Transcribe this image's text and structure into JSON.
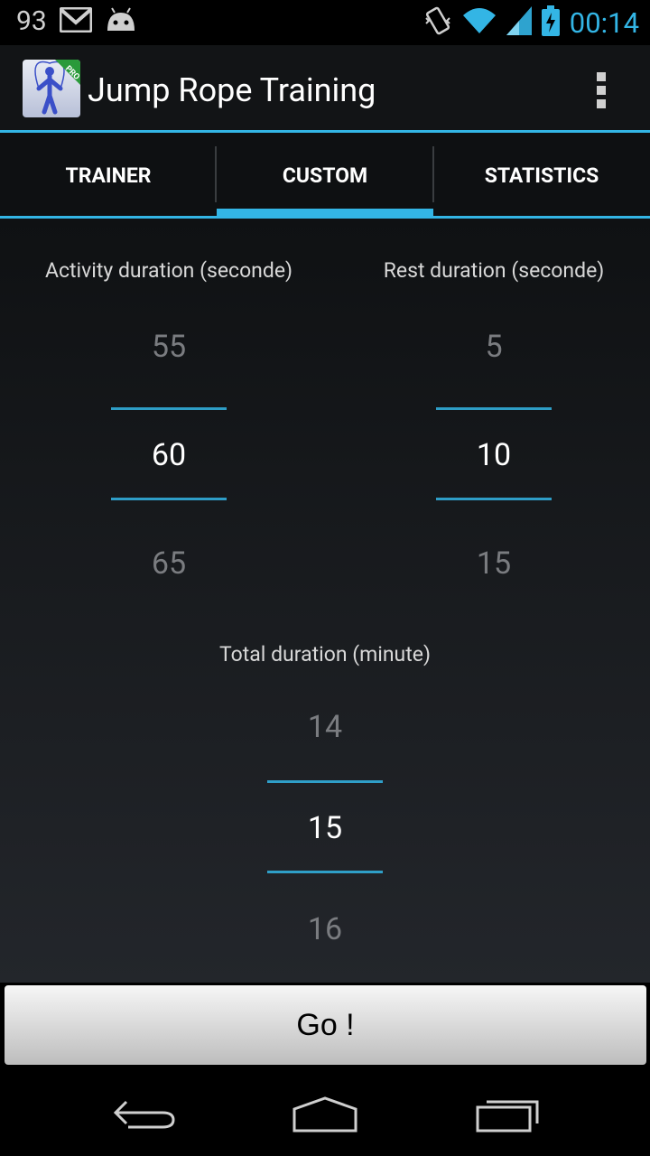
{
  "status_bar": {
    "notification_count": "93",
    "time": "00:14",
    "icons": [
      "gmail-icon",
      "android-icon",
      "vibrate-icon",
      "wifi-icon",
      "signal-icon",
      "battery-charging-icon"
    ]
  },
  "action_bar": {
    "title": "Jump Rope Training",
    "app_icon": "jump-rope-icon",
    "app_icon_badge": "PRO",
    "overflow_icon": "overflow-menu-icon"
  },
  "tabs": [
    {
      "label": "TRAINER",
      "active": false
    },
    {
      "label": "CUSTOM",
      "active": true
    },
    {
      "label": "STATISTICS",
      "active": false
    }
  ],
  "pickers": {
    "activity": {
      "label": "Activity duration (seconde)",
      "prev": "55",
      "value": "60",
      "next": "65"
    },
    "rest": {
      "label": "Rest duration (seconde)",
      "prev": "5",
      "value": "10",
      "next": "15"
    },
    "total": {
      "label": "Total duration (minute)",
      "prev": "14",
      "value": "15",
      "next": "16"
    }
  },
  "go_button": {
    "label": "Go !"
  },
  "nav_bar": {
    "icons": [
      "back-icon",
      "home-icon",
      "recent-apps-icon"
    ]
  },
  "colors": {
    "accent": "#33b5e5",
    "background": "#000000"
  }
}
